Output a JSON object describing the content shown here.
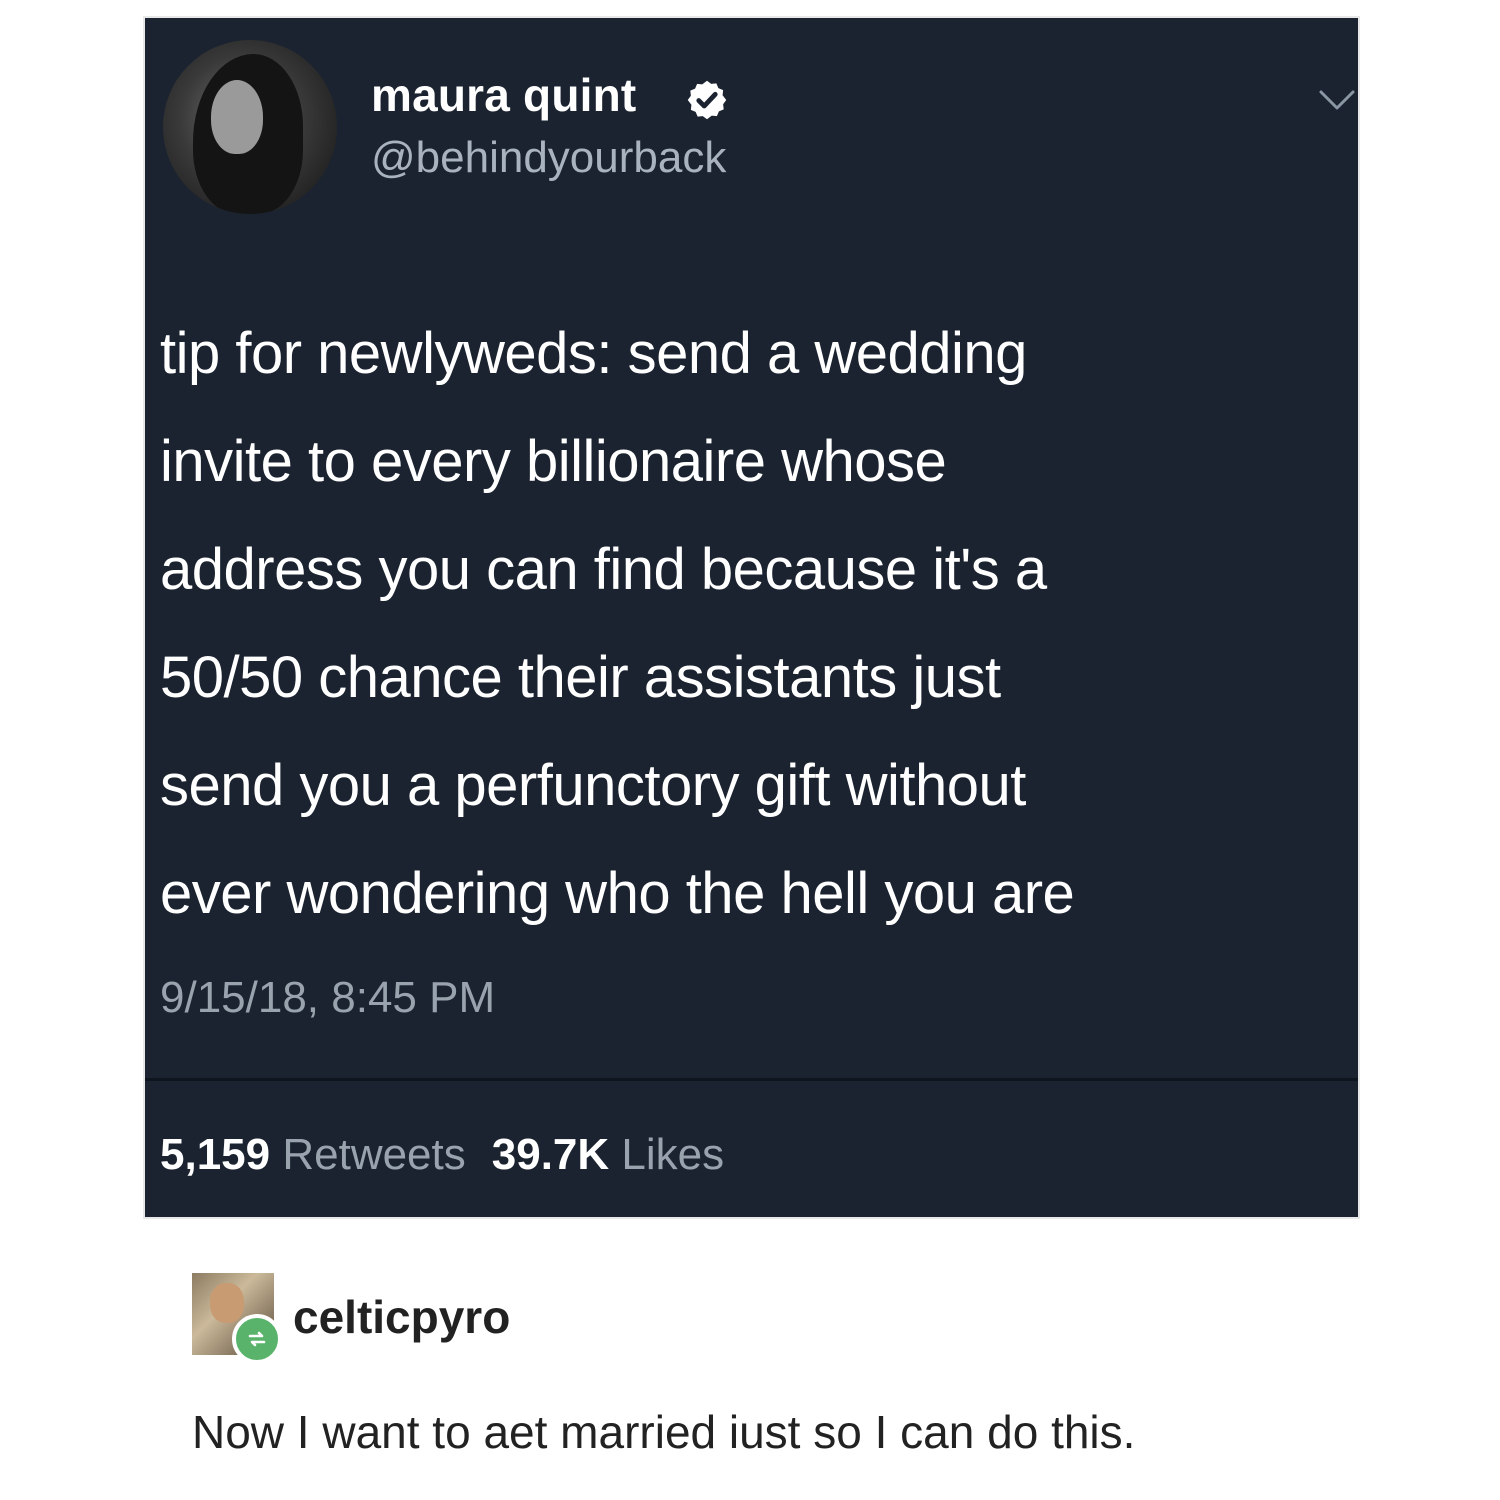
{
  "tweet": {
    "author": {
      "display_name": "maura quint",
      "handle": "@behindyourback",
      "verified": true
    },
    "text_lines": [
      "tip for newlyweds: send a wedding",
      "invite to every billionaire whose",
      "address you can find because it's a",
      "50/50 chance their assistants just",
      "send you a perfunctory gift without",
      "ever wondering who the hell you are"
    ],
    "timestamp": "9/15/18, 8:45 PM",
    "stats": {
      "retweets_count": "5,159",
      "retweets_label": "Retweets",
      "likes_count": "39.7K",
      "likes_label": "Likes"
    },
    "icons": {
      "verified": "verified-badge-icon",
      "menu": "chevron-down-icon"
    }
  },
  "reblog": {
    "username": "celticpyro",
    "comment": "Now I want to aet married iust so I can do this.",
    "badge_icon": "reblog-icon",
    "badge_color": "#59b36b"
  },
  "colors": {
    "card_background": "#1b2330",
    "primary_text": "#ffffff",
    "secondary_text": "#98a3ae"
  }
}
